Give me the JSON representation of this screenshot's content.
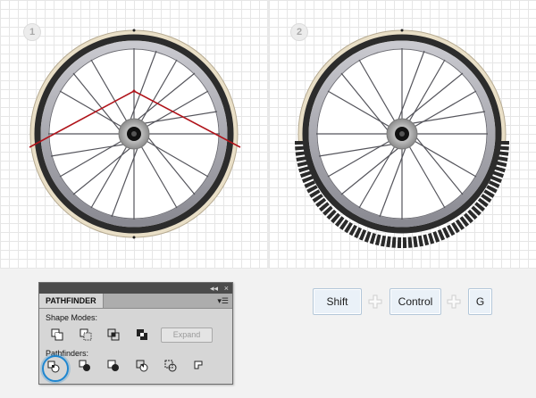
{
  "steps": [
    "1",
    "2"
  ],
  "pathfinder": {
    "tab_label": "PATHFINDER",
    "collapse_glyph": "◂◂",
    "close_glyph": "×",
    "menu_glyph": "▾☰",
    "shape_modes_label": "Shape Modes:",
    "expand_label": "Expand",
    "pathfinders_label": "Pathfinders:",
    "shape_mode_icons": [
      "unite-icon",
      "minus-front-icon",
      "intersect-icon",
      "exclude-icon"
    ],
    "pathfinder_icons": [
      "divide-icon",
      "trim-icon",
      "merge-icon",
      "crop-icon",
      "outline-icon",
      "minus-back-icon"
    ],
    "highlighted": "divide-icon"
  },
  "shortcut": {
    "keys": [
      "Shift",
      "Control",
      "G"
    ],
    "separator_icon": "plus-icon"
  },
  "colors": {
    "highlight": "#1e86d0",
    "cut_line": "#b0141b",
    "tire_wall": "#e7dcc4",
    "tire": "#2a2a2a"
  }
}
